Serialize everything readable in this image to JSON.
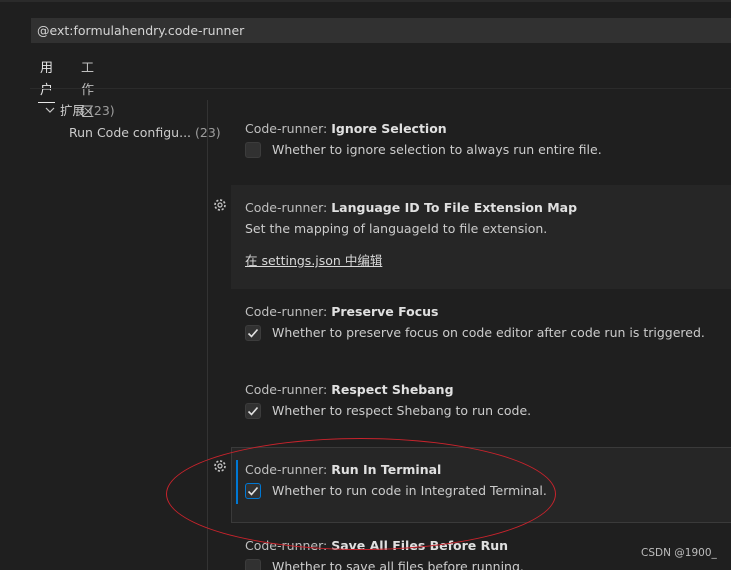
{
  "search": {
    "value": "@ext:formulahendry.code-runner"
  },
  "tabs": [
    {
      "label": "用户"
    },
    {
      "label": "工作区"
    }
  ],
  "toc": {
    "group": {
      "label": "扩展",
      "count": "(23)"
    },
    "item": {
      "label": "Run Code configu...",
      "count": "(23)"
    }
  },
  "settings": [
    {
      "category": "Code-runner: ",
      "name": "Ignore Selection",
      "description": "Whether to ignore selection to always run entire file.",
      "checked": false
    },
    {
      "category": "Code-runner: ",
      "name": "Language ID To File Extension Map",
      "description": "Set the mapping of languageId to file extension.",
      "link": "在 settings.json 中编辑"
    },
    {
      "category": "Code-runner: ",
      "name": "Preserve Focus",
      "description": "Whether to preserve focus on code editor after code run is triggered.",
      "checked": true
    },
    {
      "category": "Code-runner: ",
      "name": "Respect Shebang",
      "description": "Whether to respect Shebang to run code.",
      "checked": true
    },
    {
      "category": "Code-runner: ",
      "name": "Run In Terminal",
      "description": "Whether to run code in Integrated Terminal.",
      "checked": true
    },
    {
      "category": "Code-runner: ",
      "name": "Save All Files Before Run",
      "description": "Whether to save all files before running.",
      "checked": false
    }
  ],
  "icons": {
    "gear": "gear-icon",
    "check": "check-icon",
    "chevron": "chevron-down-icon"
  },
  "colors": {
    "accent": "#0078d4",
    "annotation": "#c8232c"
  },
  "watermark": "CSDN @1900_"
}
